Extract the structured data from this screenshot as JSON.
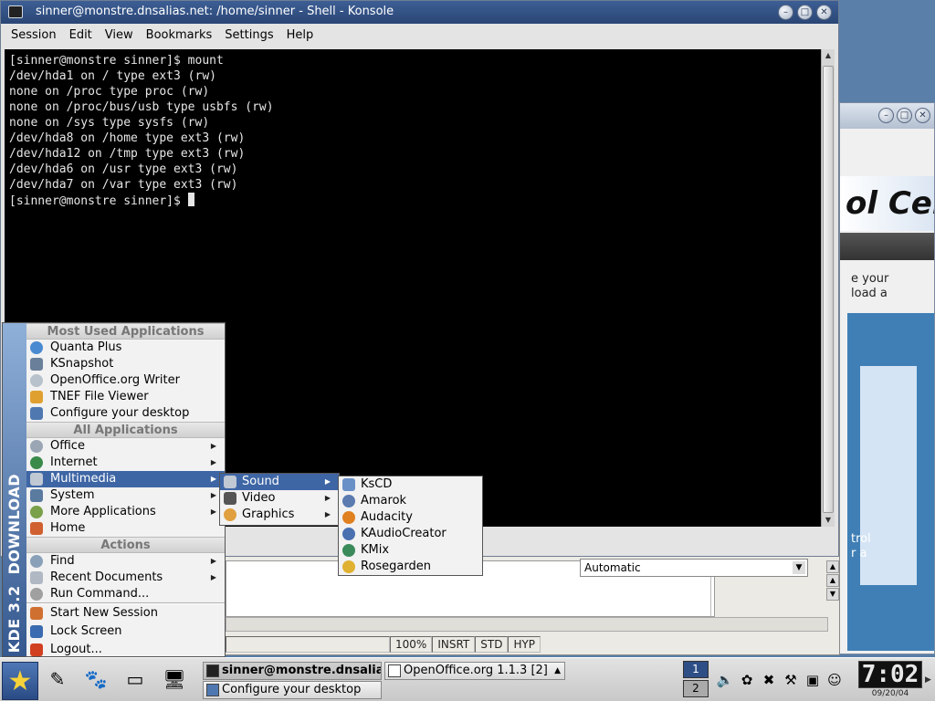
{
  "konsole": {
    "title": "sinner@monstre.dnsalias.net: /home/sinner - Shell - Konsole",
    "menu": [
      "Session",
      "Edit",
      "View",
      "Bookmarks",
      "Settings",
      "Help"
    ],
    "terminal_lines": [
      "[sinner@monstre sinner]$ mount",
      "/dev/hda1 on / type ext3 (rw)",
      "none on /proc type proc (rw)",
      "none on /proc/bus/usb type usbfs (rw)",
      "none on /sys type sysfs (rw)",
      "/dev/hda8 on /home type ext3 (rw)",
      "/dev/hda12 on /tmp type ext3 (rw)",
      "/dev/hda6 on /usr type ext3 (rw)",
      "/dev/hda7 on /var type ext3 (rw)",
      "[sinner@monstre sinner]$ "
    ]
  },
  "kmenu": {
    "sidebar_brand": "KDE 3.2",
    "sidebar_tag": "DOWNLOAD",
    "header_most_used": "Most Used Applications",
    "most_used": [
      "Quanta Plus",
      "KSnapshot",
      "OpenOffice.org Writer",
      "TNEF File Viewer",
      "Configure your desktop"
    ],
    "header_all": "All Applications",
    "all_apps": [
      "Office",
      "Internet",
      "Multimedia",
      "System",
      "More Applications",
      "Home"
    ],
    "header_actions": "Actions",
    "actions": [
      "Find",
      "Recent Documents",
      "Run Command..."
    ],
    "session": [
      "Start New Session",
      "Lock Screen",
      "Logout..."
    ]
  },
  "submenu_multimedia": [
    "Sound",
    "Video",
    "Graphics"
  ],
  "submenu_sound": [
    "KsCD",
    "Amarok",
    "Audacity",
    "KAudioCreator",
    "KMix",
    "Rosegarden"
  ],
  "openoffice": {
    "combo_value": "Automatic",
    "zoom": "100%",
    "insert_mode": "INSRT",
    "selection_mode": "STD",
    "hyperlink_mode": "HYP"
  },
  "control_window": {
    "banner": "ol Cen",
    "text1": [
      "e your",
      " load a"
    ],
    "text2": [
      "trol",
      "r a"
    ]
  },
  "taskbar": {
    "tasks": {
      "konsole": "sinner@monstre.dnsalias.net",
      "configure": "Configure your desktop",
      "openoffice": "OpenOffice.org 1.1.3 [2]"
    },
    "pager": [
      "1",
      "2"
    ],
    "clock_time": "7:02",
    "clock_date": "09/20/04"
  },
  "colors": {
    "titlebar": "#2a4675",
    "menu_highlight": "#3e66a5",
    "terminal_bg": "#000000",
    "desktop": "#5a7fa8"
  }
}
